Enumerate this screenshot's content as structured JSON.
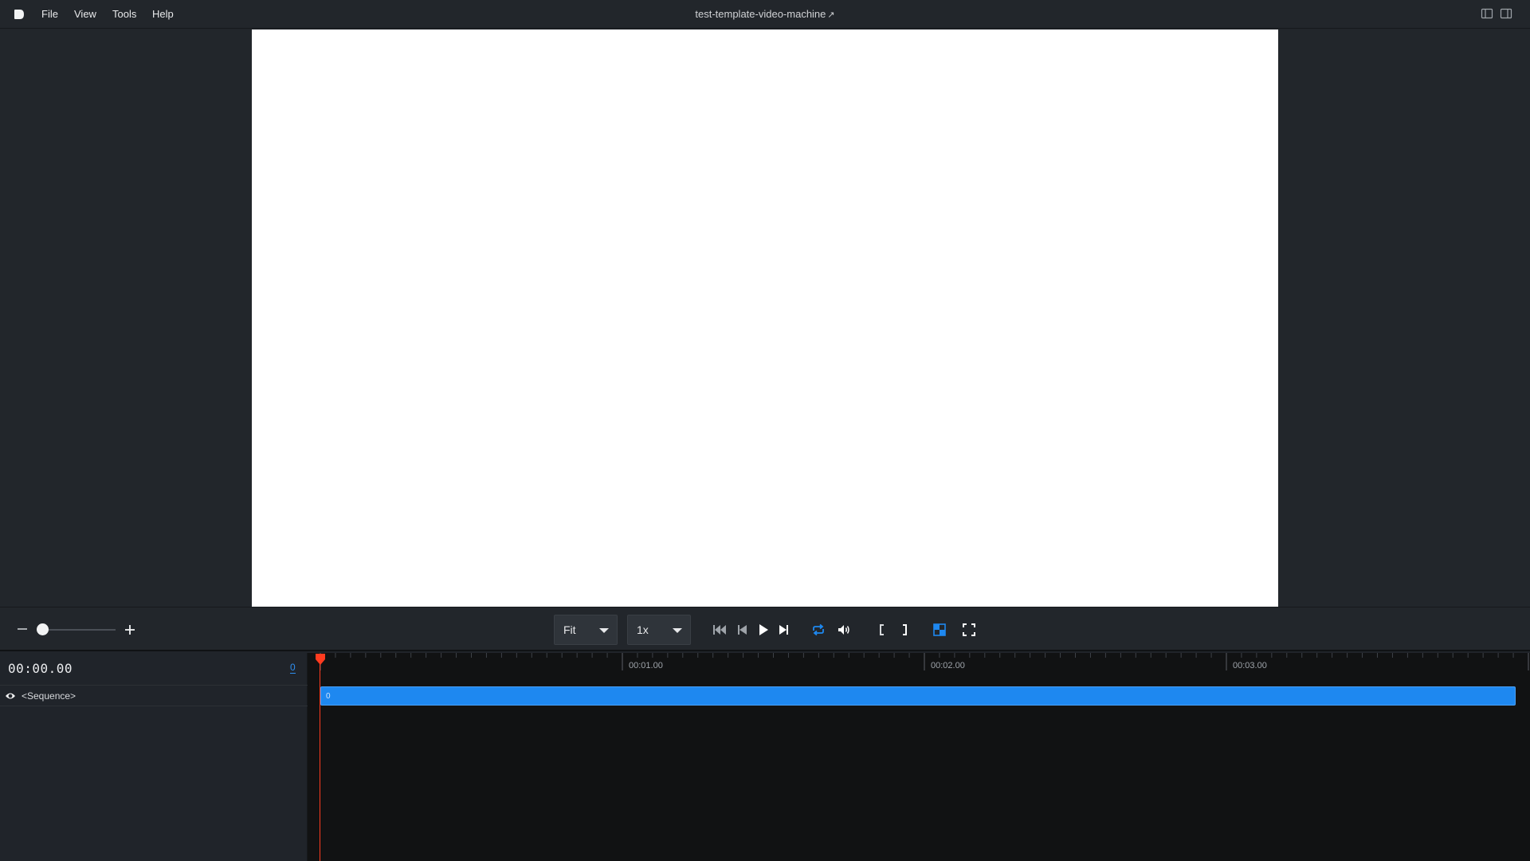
{
  "menubar": {
    "items": [
      "File",
      "View",
      "Tools",
      "Help"
    ],
    "title": "test-template-video-machine",
    "external_icon": "external-link-icon"
  },
  "controls": {
    "fit_select": {
      "value": "Fit"
    },
    "speed_select": {
      "value": "1x"
    },
    "zoom_level": 0.05,
    "icons": [
      "skip-to-start-icon",
      "step-back-icon",
      "play-icon",
      "step-forward-icon",
      "loop-icon",
      "volume-icon",
      "in-point-icon",
      "out-point-icon",
      "transparency-icon",
      "fullscreen-icon"
    ]
  },
  "timeline": {
    "timecode": "00:00.00",
    "frame": "0",
    "ticks": [
      "00:01.00",
      "00:02.00",
      "00:03.00"
    ],
    "layers": [
      {
        "name": "<Sequence>",
        "label": "0"
      }
    ]
  },
  "colors": {
    "accent": "#1e88f0",
    "playhead": "#ff3b1f"
  }
}
